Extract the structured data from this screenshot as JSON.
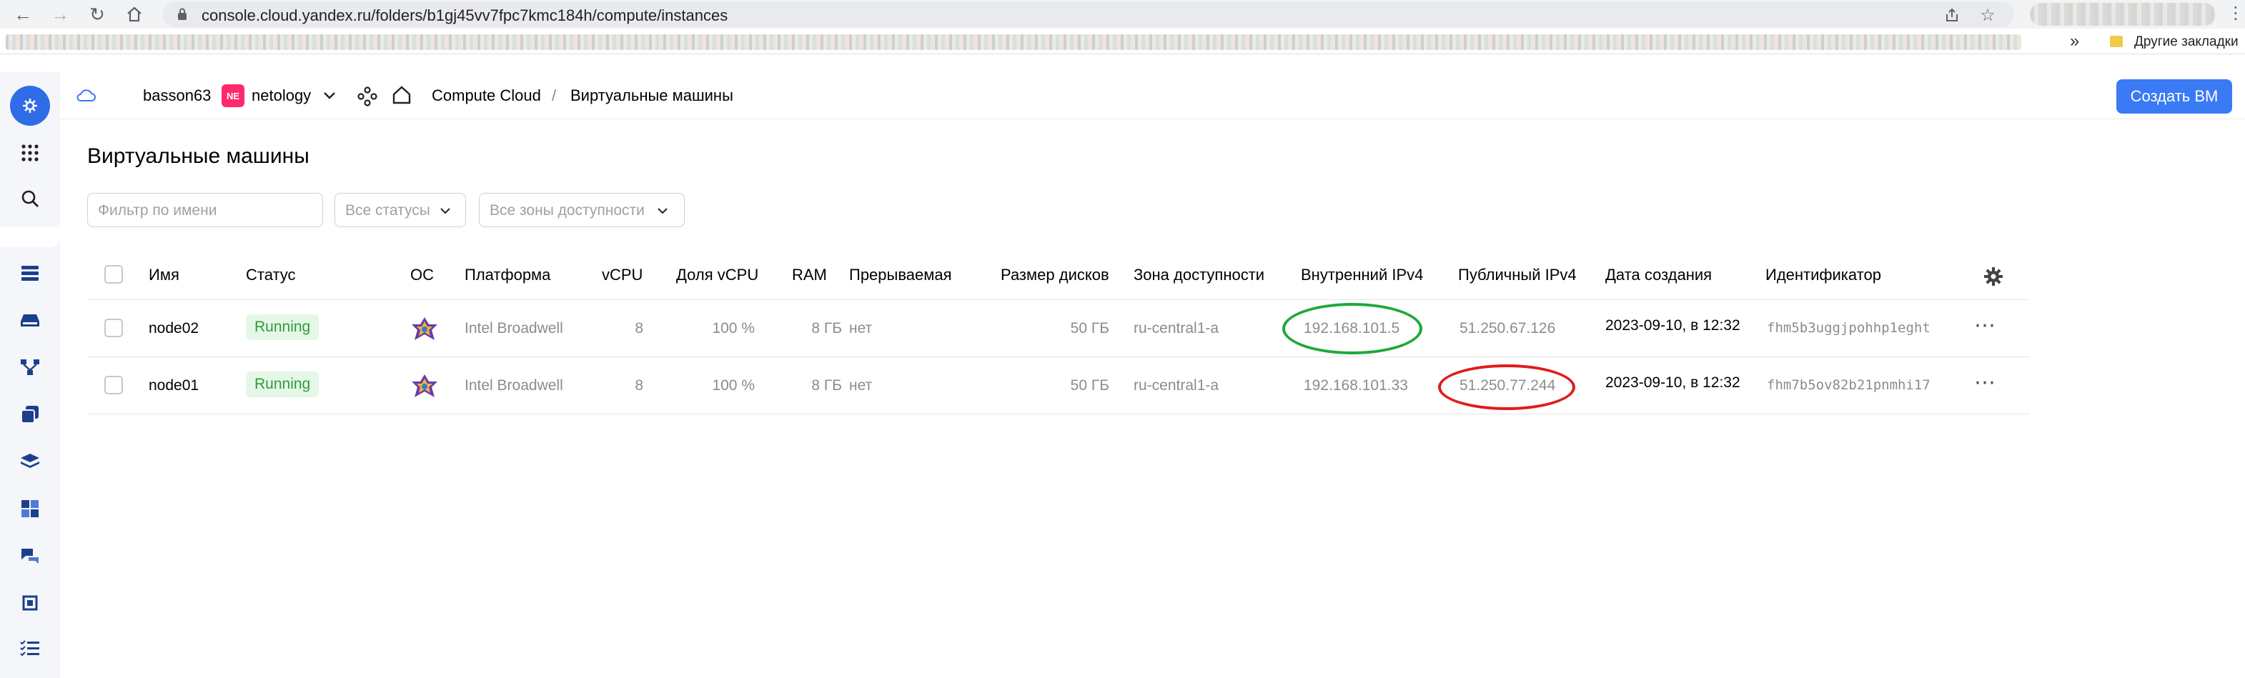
{
  "browser": {
    "url": "console.cloud.yandex.ru/folders/b1gj45vv7fpc7kmc184h/compute/instances",
    "other_bookmarks": "Другие закладки"
  },
  "header": {
    "user": "basson63",
    "org_badge": "NE",
    "org_name": "netology",
    "breadcrumb_service": "Compute Cloud",
    "breadcrumb_sep": "/",
    "breadcrumb_page": "Виртуальные машины",
    "create_button": "Создать ВМ"
  },
  "page": {
    "title": "Виртуальные машины",
    "filters": {
      "name_placeholder": "Фильтр по имени",
      "status": "Все статусы",
      "zone": "Все зоны доступности"
    }
  },
  "table": {
    "columns": {
      "name": "Имя",
      "status": "Статус",
      "os": "ОС",
      "platform": "Платформа",
      "vcpu": "vCPU",
      "vcpu_share": "Доля vCPU",
      "ram": "RAM",
      "preemptible": "Прерываемая",
      "disk_size": "Размер дисков",
      "zone": "Зона доступности",
      "internal_ip": "Внутренний IPv4",
      "public_ip": "Публичный IPv4",
      "created": "Дата создания",
      "id": "Идентификатор"
    },
    "rows": [
      {
        "name": "node02",
        "status": "Running",
        "platform": "Intel Broadwell",
        "vcpu": "8",
        "vcpu_share": "100 %",
        "ram": "8 ГБ",
        "preemptible": "нет",
        "disk_size": "50 ГБ",
        "zone": "ru-central1-a",
        "internal_ip": "192.168.101.5",
        "public_ip": "51.250.67.126",
        "created": "2023-09-10, в 12:32",
        "id": "fhm5b3uggjpohhp1eght"
      },
      {
        "name": "node01",
        "status": "Running",
        "platform": "Intel Broadwell",
        "vcpu": "8",
        "vcpu_share": "100 %",
        "ram": "8 ГБ",
        "preemptible": "нет",
        "disk_size": "50 ГБ",
        "zone": "ru-central1-a",
        "internal_ip": "192.168.101.33",
        "public_ip": "51.250.77.244",
        "created": "2023-09-10, в 12:32",
        "id": "fhm7b5ov82b21pnmhi17"
      }
    ]
  },
  "annotations": {
    "internal_ip_highlight_color": "#1fa83a",
    "public_ip_highlight_color": "#e01b1b"
  },
  "colors": {
    "accent": "#3a7af4",
    "running_bg": "#e5f7e6",
    "running_text": "#2e9b3b",
    "org_badge": "#ff2a6b"
  }
}
